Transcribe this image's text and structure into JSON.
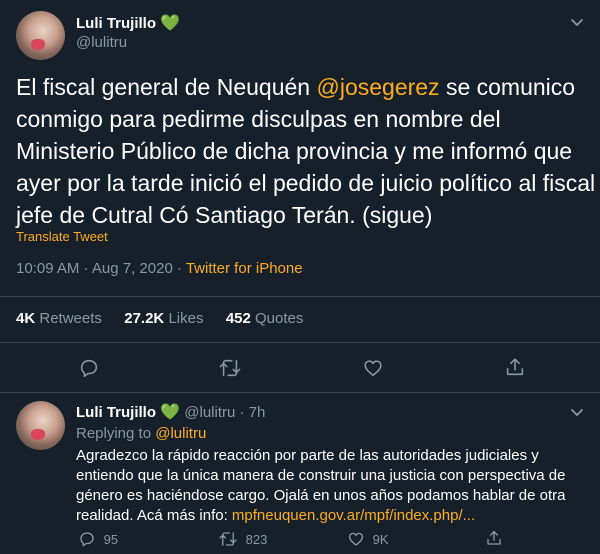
{
  "colors": {
    "background": "#15202b",
    "accent": "#ffad1f",
    "muted": "#8899a6",
    "verified": "#3aa65a",
    "divider": "#38444d"
  },
  "main_tweet": {
    "author_name": "Luli Trujillo",
    "heart": "💚",
    "handle": "@lulitru",
    "text_lines": [
      "El fiscal general de Neuquén ",
      "@josegerez",
      " se comunico",
      "conmigo para pedirme disculpas en nombre del",
      "Ministerio Público de dicha provincia y me informó que",
      "ayer por la tarde inició el pedido de juicio político al fiscal",
      "jefe de Cutral Có Santiago Terán. (sigue)"
    ],
    "translate": "Translate Tweet",
    "timestamp": "10:09 AM · Aug 7, 2020 · ",
    "source": "Twitter for iPhone",
    "stats": {
      "retweets_count": "4K",
      "retweets_label": "Retweets",
      "likes_count": "27.2K",
      "likes_label": "Likes",
      "quotes_count": "452",
      "quotes_label": "Quotes"
    },
    "action_icons": [
      "reply-icon",
      "retweet-icon",
      "like-icon",
      "share-icon"
    ]
  },
  "reply_tweet": {
    "author_name": "Luli Trujillo",
    "heart": "💚",
    "handle": "@lulitru",
    "time": "· 7h",
    "replying_label": "Replying to ",
    "replying_handle": "@lulitru",
    "text_lines": [
      "Agradezco la rápido reacción por parte de las autoridades judiciales y",
      "entiendo que la única manera de construir una justicia con perspectiva de",
      "género es haciéndose cargo. Ojalá en unos años podamos hablar de otra",
      "realidad. Acá más info: ",
      "mpfneuquen.gov.ar/mpf/index.php/..."
    ],
    "reply_count": "95",
    "retweet_count": "823",
    "like_count": "9K"
  }
}
